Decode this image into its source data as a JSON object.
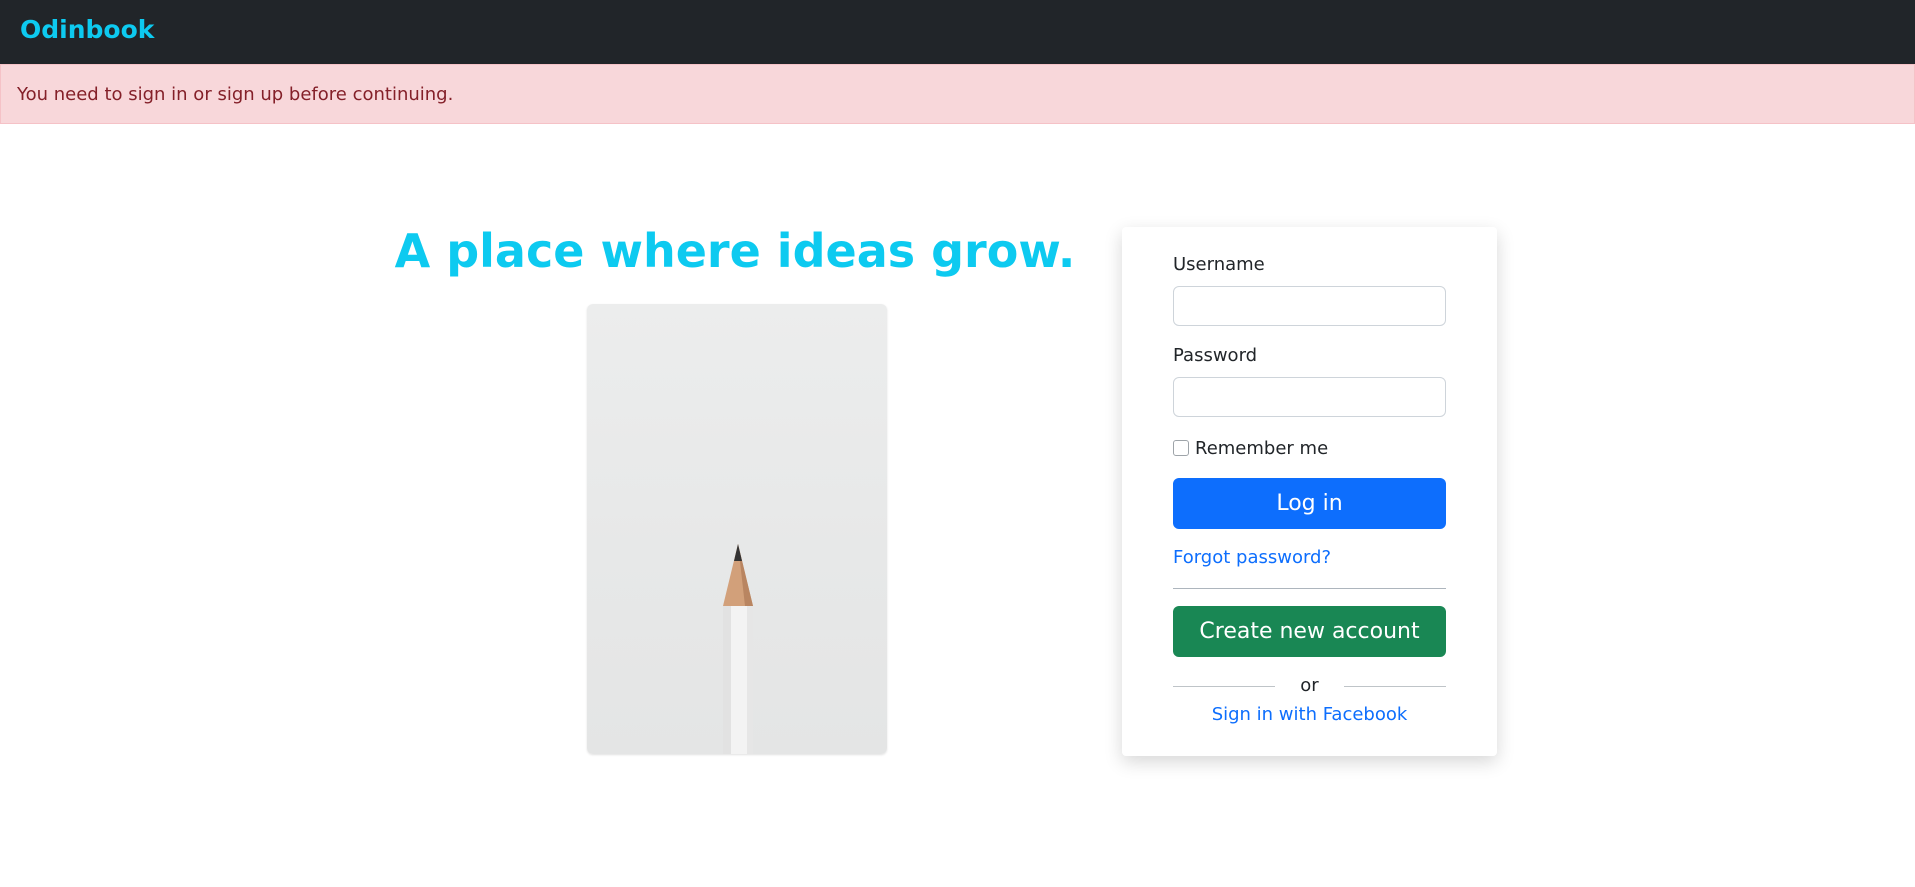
{
  "navbar": {
    "brand": "Odinbook"
  },
  "alert": {
    "message": "You need to sign in or sign up before continuing."
  },
  "hero": {
    "tagline": "A place where ideas grow."
  },
  "login": {
    "username_label": "Username",
    "username_value": "",
    "password_label": "Password",
    "password_value": "",
    "remember_label": "Remember me",
    "remember_checked": false,
    "submit_label": "Log in",
    "forgot_label": "Forgot password?",
    "create_label": "Create new account",
    "or_label": "or",
    "facebook_label": "Sign in with Facebook"
  },
  "colors": {
    "brand": "#0dcaf0",
    "navbar": "#212529",
    "alert_bg": "#f8d7da",
    "alert_text": "#842029",
    "primary": "#0d6efd",
    "success": "#198754"
  }
}
